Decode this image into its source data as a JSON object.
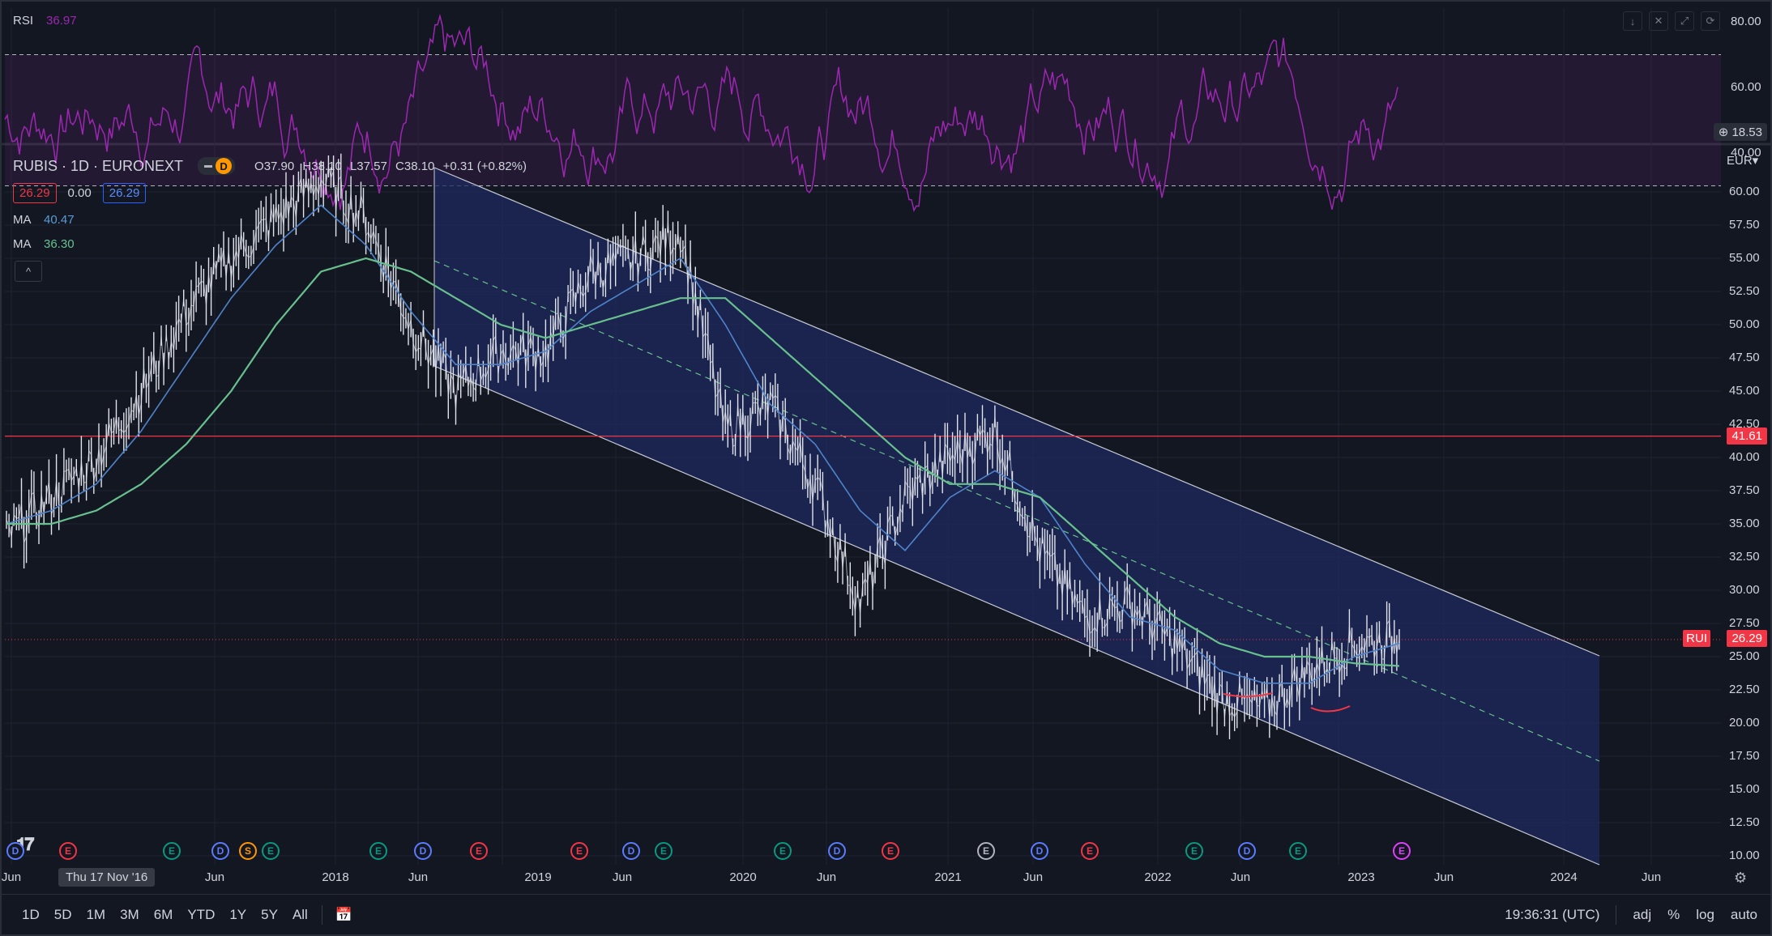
{
  "rsi_panel": {
    "title": "RSI",
    "value": "36.97",
    "axis": [
      "80.00",
      "60.00",
      "40.00"
    ],
    "add_badge": "18.53",
    "color": "#9c27b0",
    "band_upper": 70,
    "band_lower": 30
  },
  "legend": {
    "symbol": "RUBIS · 1D · EURONEXT",
    "chip": "D",
    "open": "O37.90",
    "high": "H38.10",
    "low": "L37.57",
    "close": "C38.10",
    "change": "+0.31 (+0.82%)",
    "bid": "26.29",
    "spread": "0.00",
    "ask": "26.29",
    "ma1_label": "MA",
    "ma1_value": "40.47",
    "ma2_label": "MA",
    "ma2_value": "36.30",
    "collapse": "^"
  },
  "price_axis": {
    "currency": "EUR",
    "ticks": [
      "60.00",
      "57.50",
      "55.00",
      "52.50",
      "50.00",
      "47.50",
      "45.00",
      "42.50",
      "40.00",
      "37.50",
      "35.00",
      "32.50",
      "30.00",
      "27.50",
      "25.00",
      "22.50",
      "20.00",
      "17.50",
      "15.00",
      "12.50",
      "10.00"
    ],
    "horizontal_line_value": "41.61",
    "last_price": "26.29",
    "last_price_symbol": "RUI"
  },
  "time_axis": {
    "labels": [
      "Jun",
      "Thu 17 Nov '16",
      "Jun",
      "2018",
      "Jun",
      "2019",
      "Jun",
      "2020",
      "Jun",
      "2021",
      "Jun",
      "2022",
      "Jun",
      "2023",
      "Jun",
      "2024",
      "Jun"
    ],
    "crosshair_label": "Thu 17 Nov '16"
  },
  "events": [
    {
      "t": "D",
      "c": "ev-D"
    },
    {
      "t": "E",
      "c": "ev-E-red"
    },
    {
      "t": "E",
      "c": "ev-E-teal"
    },
    {
      "t": "D",
      "c": "ev-D"
    },
    {
      "t": "S",
      "c": "ev-S"
    },
    {
      "t": "E",
      "c": "ev-E-teal"
    },
    {
      "t": "E",
      "c": "ev-E-teal"
    },
    {
      "t": "D",
      "c": "ev-D"
    },
    {
      "t": "E",
      "c": "ev-E-red"
    },
    {
      "t": "E",
      "c": "ev-E-red"
    },
    {
      "t": "D",
      "c": "ev-D"
    },
    {
      "t": "E",
      "c": "ev-E-teal"
    },
    {
      "t": "E",
      "c": "ev-E-teal"
    },
    {
      "t": "D",
      "c": "ev-D"
    },
    {
      "t": "E",
      "c": "ev-E-red"
    },
    {
      "t": "E",
      "c": "ev-E-gray"
    },
    {
      "t": "D",
      "c": "ev-D"
    },
    {
      "t": "E",
      "c": "ev-E-red"
    },
    {
      "t": "E",
      "c": "ev-E-teal"
    },
    {
      "t": "D",
      "c": "ev-D"
    },
    {
      "t": "E",
      "c": "ev-E-teal"
    },
    {
      "t": "E",
      "c": "ev-E-pink"
    }
  ],
  "bottom_bar": {
    "ranges": [
      "1D",
      "5D",
      "1M",
      "3M",
      "6M",
      "YTD",
      "1Y",
      "5Y",
      "All"
    ],
    "clock": "19:36:31 (UTC)",
    "adj": "adj",
    "percent": "%",
    "log": "log",
    "auto": "auto"
  },
  "colors": {
    "background": "#131722",
    "price": "#e0e3eb",
    "ma_fast": "#4f83cc",
    "ma_slow": "#69c08f",
    "channel_fill": "#1e2a5e",
    "hline": "#f23645",
    "rsi": "#9c27b0"
  },
  "chart_data": {
    "type": "line",
    "title": "RUBIS · 1D · EURONEXT",
    "ylim": [
      10,
      62.5
    ],
    "series": [
      {
        "name": "RUBIS",
        "x": [
          "2016-07",
          "2016-11",
          "2017-02",
          "2017-05",
          "2017-08",
          "2017-11",
          "2018-02",
          "2018-05",
          "2018-06",
          "2018-09",
          "2018-12",
          "2019-03",
          "2019-06",
          "2019-09",
          "2019-12",
          "2020-02",
          "2020-03",
          "2020-06",
          "2020-09",
          "2020-10",
          "2020-12",
          "2021-03",
          "2021-06",
          "2021-09",
          "2021-12",
          "2022-03",
          "2022-06",
          "2022-09",
          "2022-10",
          "2022-12",
          "2023-02",
          "2023-03"
        ],
        "values": [
          34,
          37,
          40,
          45,
          51,
          55,
          58,
          61,
          58,
          50,
          45,
          48,
          48,
          54,
          55,
          57,
          42,
          44,
          38,
          29,
          37,
          40,
          42,
          33,
          28,
          29,
          26,
          22,
          21,
          24,
          26,
          26.3
        ]
      },
      {
        "name": "MA",
        "values": [
          35,
          36,
          38,
          42,
          47,
          52,
          56,
          59,
          56,
          51,
          47,
          47,
          48,
          51,
          53,
          55,
          50,
          44,
          41,
          36,
          33,
          37,
          39,
          37,
          32,
          28,
          27,
          24,
          23,
          23,
          25,
          26
        ]
      },
      {
        "name": "MA",
        "values": [
          35,
          35,
          36,
          38,
          41,
          45,
          50,
          54,
          55,
          54,
          52,
          50,
          49,
          50,
          51,
          52,
          52,
          49,
          46,
          43,
          40,
          38,
          38,
          37,
          34,
          31,
          28,
          26,
          25,
          25,
          24.5,
          24.3
        ]
      }
    ]
  }
}
